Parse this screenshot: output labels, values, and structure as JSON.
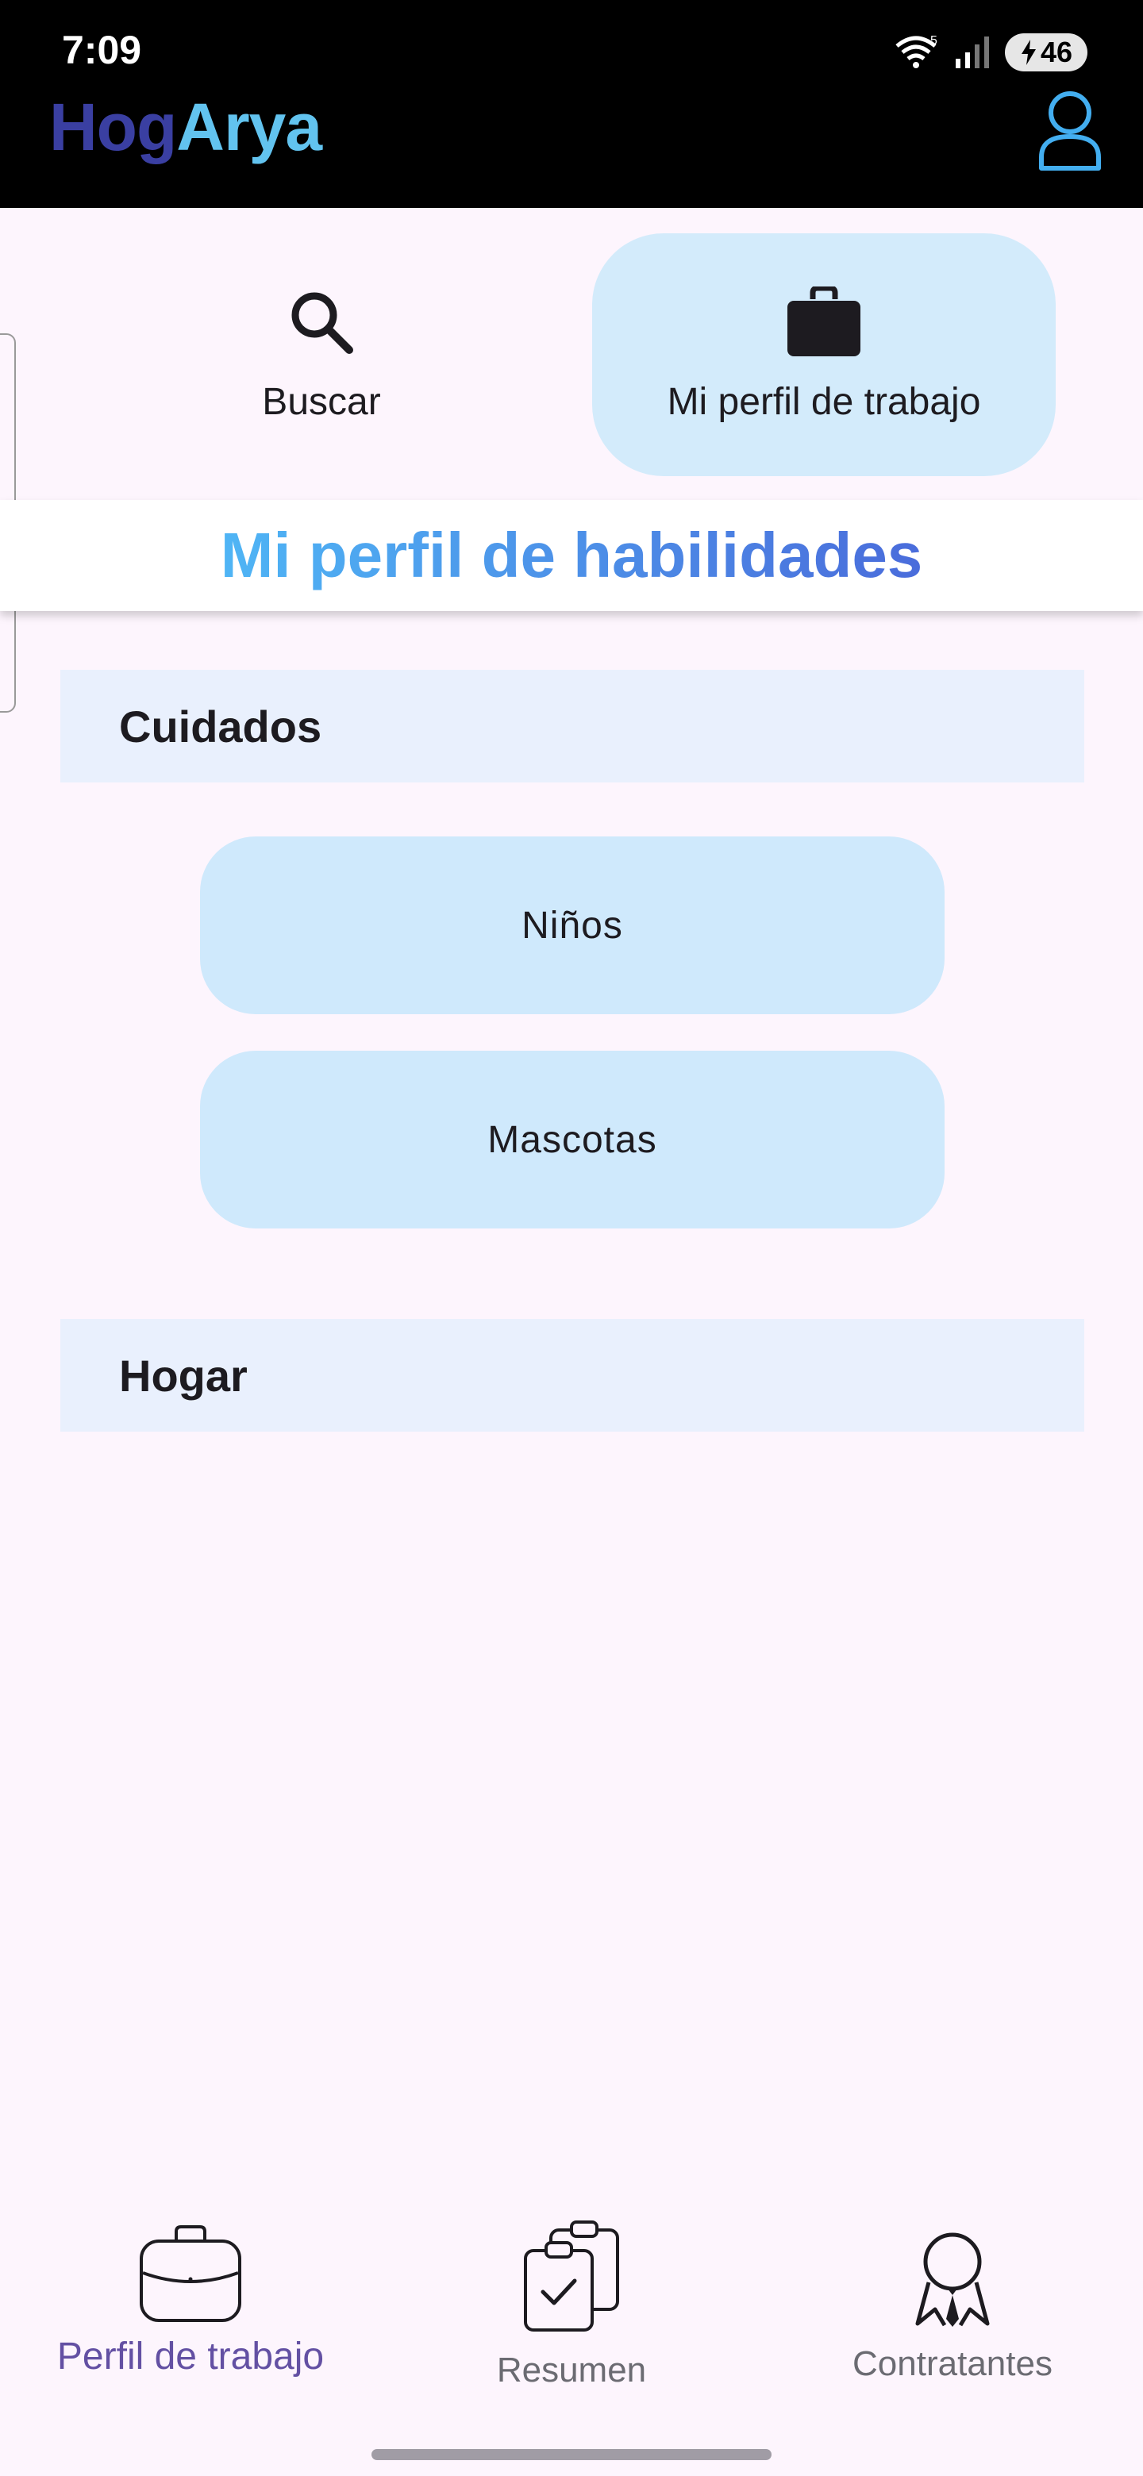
{
  "status_bar": {
    "time": "7:09",
    "network_label": "5",
    "battery_level": "46",
    "icons": [
      "wifi-icon",
      "signal-icon",
      "charging-icon"
    ]
  },
  "app_bar": {
    "brand_part_1": "Hog",
    "brand_part_2": "Arya",
    "profile_icon": "person-icon"
  },
  "top_nav": {
    "search_label": "Buscar",
    "search_icon": "search-icon",
    "work_label": "Mi perfil de trabajo",
    "work_icon": "briefcase-icon",
    "selected": "work"
  },
  "page_title": "Mi perfil de habilidades",
  "sections": [
    {
      "title": "Cuidados",
      "skills": [
        "Niños",
        "Mascotas"
      ]
    },
    {
      "title": "Hogar",
      "skills": []
    }
  ],
  "bottom_nav": {
    "items": [
      {
        "label": "Perfil de trabajo",
        "icon": "briefcase-outline-icon",
        "active": true
      },
      {
        "label": "Resumen",
        "icon": "clipboard-check-icon",
        "active": false
      },
      {
        "label": "Contratantes",
        "icon": "person-tie-icon",
        "active": false
      }
    ]
  },
  "colors": {
    "background": "#fdf5fd",
    "app_bar": "#000000",
    "brand_dark": "#3a3fa2",
    "brand_light": "#62c3ef",
    "selected_pill": "#d3ebfb",
    "section_header": "#e9f0fd",
    "skill_pill": "#cfe9fc",
    "active_nav": "#6350a3"
  }
}
